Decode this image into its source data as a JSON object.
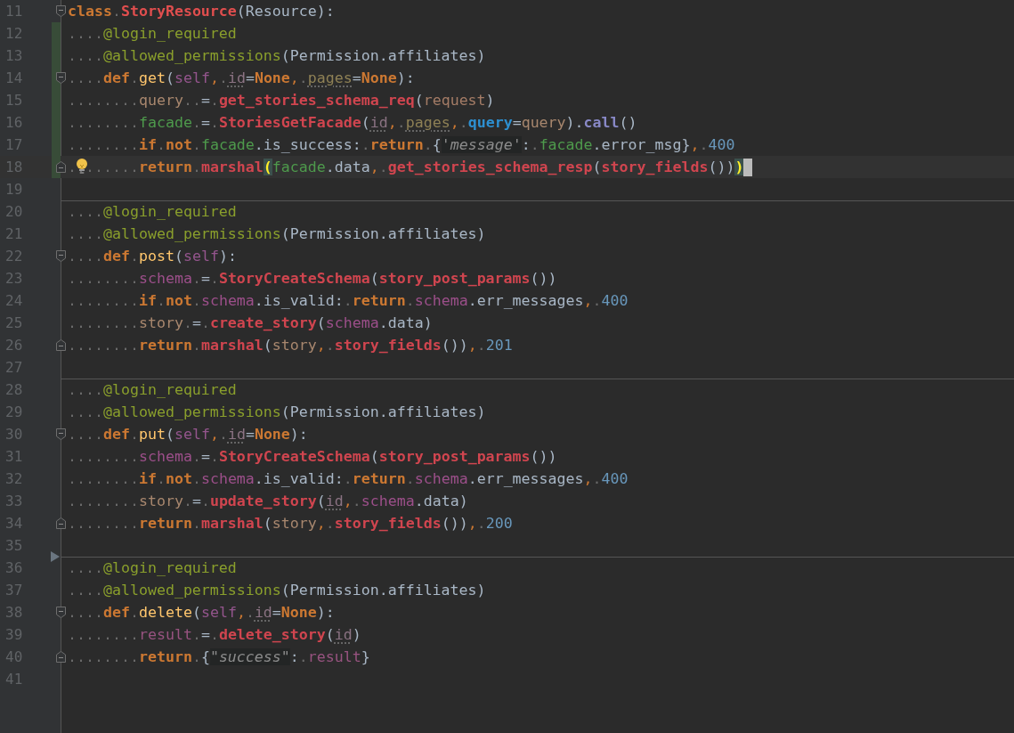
{
  "editor": {
    "lines": [
      {
        "number": "11",
        "fold_start": true,
        "tokens": [
          {
            "kind": "kw",
            "text": "class"
          },
          {
            "kind": "ws",
            "text": "."
          },
          {
            "kind": "cls",
            "text": "StoryResource"
          },
          {
            "kind": "plain",
            "text": "(Resource):"
          }
        ]
      },
      {
        "number": "12",
        "changed": true,
        "tokens": [
          {
            "kind": "ws",
            "text": "...."
          },
          {
            "kind": "dec",
            "text": "@login_required"
          }
        ]
      },
      {
        "number": "13",
        "changed": true,
        "tokens": [
          {
            "kind": "ws",
            "text": "...."
          },
          {
            "kind": "dec",
            "text": "@allowed_permissions"
          },
          {
            "kind": "plain",
            "text": "(Permission.affiliates)"
          }
        ]
      },
      {
        "number": "14",
        "fold_start": true,
        "changed": true,
        "tokens": [
          {
            "kind": "ws",
            "text": "...."
          },
          {
            "kind": "kw",
            "text": "def"
          },
          {
            "kind": "ws",
            "text": "."
          },
          {
            "kind": "fn",
            "text": "get"
          },
          {
            "kind": "plain",
            "text": "("
          },
          {
            "kind": "self",
            "text": "self"
          },
          {
            "kind": "comma",
            "text": ","
          },
          {
            "kind": "ws",
            "text": "."
          },
          {
            "kind": "param",
            "text": "id",
            "color": "#8b7383"
          },
          {
            "kind": "plain",
            "text": "="
          },
          {
            "kind": "kw",
            "text": "None"
          },
          {
            "kind": "comma",
            "text": ","
          },
          {
            "kind": "ws",
            "text": "."
          },
          {
            "kind": "param",
            "text": "pages",
            "color": "#8e8055"
          },
          {
            "kind": "plain",
            "text": "="
          },
          {
            "kind": "kw",
            "text": "None"
          },
          {
            "kind": "plain",
            "text": "):"
          }
        ]
      },
      {
        "number": "15",
        "changed": true,
        "tokens": [
          {
            "kind": "ws",
            "text": "........"
          },
          {
            "kind": "var",
            "text": "query",
            "color": "#a8876e"
          },
          {
            "kind": "ws",
            "text": ".."
          },
          {
            "kind": "plain",
            "text": "="
          },
          {
            "kind": "ws",
            "text": "."
          },
          {
            "kind": "call",
            "text": "get_stories_schema_req"
          },
          {
            "kind": "plain",
            "text": "("
          },
          {
            "kind": "var",
            "text": "request",
            "color": "#a47c66"
          },
          {
            "kind": "plain",
            "text": ")"
          }
        ]
      },
      {
        "number": "16",
        "changed": true,
        "tokens": [
          {
            "kind": "ws",
            "text": "........"
          },
          {
            "kind": "var",
            "text": "facade",
            "color": "#4e9a4c"
          },
          {
            "kind": "ws",
            "text": "."
          },
          {
            "kind": "plain",
            "text": "="
          },
          {
            "kind": "ws",
            "text": "."
          },
          {
            "kind": "call",
            "text": "StoriesGetFacade"
          },
          {
            "kind": "plain",
            "text": "("
          },
          {
            "kind": "param",
            "text": "id",
            "color": "#8b7383"
          },
          {
            "kind": "comma",
            "text": ","
          },
          {
            "kind": "ws",
            "text": "."
          },
          {
            "kind": "param",
            "text": "pages",
            "color": "#8e8055"
          },
          {
            "kind": "comma",
            "text": ","
          },
          {
            "kind": "ws",
            "text": "."
          },
          {
            "kind": "kwarg",
            "text": "query"
          },
          {
            "kind": "plain",
            "text": "="
          },
          {
            "kind": "var",
            "text": "query",
            "color": "#a8876e"
          },
          {
            "kind": "plain",
            "text": ")."
          },
          {
            "kind": "method",
            "text": "call"
          },
          {
            "kind": "plain",
            "text": "()"
          }
        ]
      },
      {
        "number": "17",
        "changed": true,
        "tokens": [
          {
            "kind": "ws",
            "text": "........"
          },
          {
            "kind": "kw",
            "text": "if"
          },
          {
            "kind": "ws",
            "text": "."
          },
          {
            "kind": "kw",
            "text": "not"
          },
          {
            "kind": "ws",
            "text": "."
          },
          {
            "kind": "var",
            "text": "facade",
            "color": "#4e9a4c"
          },
          {
            "kind": "plain",
            "text": ".is_success:"
          },
          {
            "kind": "ws",
            "text": "."
          },
          {
            "kind": "kw",
            "text": "return"
          },
          {
            "kind": "ws",
            "text": "."
          },
          {
            "kind": "plain",
            "text": "{"
          },
          {
            "kind": "str",
            "text": "'message'"
          },
          {
            "kind": "plain",
            "text": ":"
          },
          {
            "kind": "ws",
            "text": "."
          },
          {
            "kind": "var",
            "text": "facade",
            "color": "#4e9a4c"
          },
          {
            "kind": "plain",
            "text": ".error_msg}"
          },
          {
            "kind": "comma",
            "text": ","
          },
          {
            "kind": "ws",
            "text": "."
          },
          {
            "kind": "num",
            "text": "400"
          }
        ]
      },
      {
        "number": "18",
        "fold_end": true,
        "changed": true,
        "current": true,
        "bulb": true,
        "cursor": true,
        "tokens": [
          {
            "kind": "ws",
            "text": "........"
          },
          {
            "kind": "kw",
            "text": "return"
          },
          {
            "kind": "ws",
            "text": "."
          },
          {
            "kind": "call",
            "text": "marshal"
          },
          {
            "kind": "brace",
            "text": "("
          },
          {
            "kind": "var",
            "text": "facade",
            "color": "#4e9a4c"
          },
          {
            "kind": "plain",
            "text": ".data"
          },
          {
            "kind": "comma",
            "text": ","
          },
          {
            "kind": "ws",
            "text": "."
          },
          {
            "kind": "call",
            "text": "get_stories_schema_resp"
          },
          {
            "kind": "plain",
            "text": "("
          },
          {
            "kind": "call",
            "text": "story_fields"
          },
          {
            "kind": "plain",
            "text": "())"
          },
          {
            "kind": "brace",
            "text": ")"
          }
        ]
      },
      {
        "number": "19"
      },
      {
        "number": "20",
        "separator": true,
        "tokens": [
          {
            "kind": "ws",
            "text": "...."
          },
          {
            "kind": "dec",
            "text": "@login_required"
          }
        ]
      },
      {
        "number": "21",
        "tokens": [
          {
            "kind": "ws",
            "text": "...."
          },
          {
            "kind": "dec",
            "text": "@allowed_permissions"
          },
          {
            "kind": "plain",
            "text": "(Permission.affiliates)"
          }
        ]
      },
      {
        "number": "22",
        "fold_start": true,
        "tokens": [
          {
            "kind": "ws",
            "text": "...."
          },
          {
            "kind": "kw",
            "text": "def"
          },
          {
            "kind": "ws",
            "text": "."
          },
          {
            "kind": "fn",
            "text": "post"
          },
          {
            "kind": "plain",
            "text": "("
          },
          {
            "kind": "self",
            "text": "self"
          },
          {
            "kind": "plain",
            "text": "):"
          }
        ]
      },
      {
        "number": "23",
        "tokens": [
          {
            "kind": "ws",
            "text": "........"
          },
          {
            "kind": "var",
            "text": "schema",
            "color": "#9c4f8a"
          },
          {
            "kind": "ws",
            "text": "."
          },
          {
            "kind": "plain",
            "text": "="
          },
          {
            "kind": "ws",
            "text": "."
          },
          {
            "kind": "call",
            "text": "StoryCreateSchema"
          },
          {
            "kind": "plain",
            "text": "("
          },
          {
            "kind": "call",
            "text": "story_post_params"
          },
          {
            "kind": "plain",
            "text": "())"
          }
        ]
      },
      {
        "number": "24",
        "tokens": [
          {
            "kind": "ws",
            "text": "........"
          },
          {
            "kind": "kw",
            "text": "if"
          },
          {
            "kind": "ws",
            "text": "."
          },
          {
            "kind": "kw",
            "text": "not"
          },
          {
            "kind": "ws",
            "text": "."
          },
          {
            "kind": "var",
            "text": "schema",
            "color": "#9c4f8a"
          },
          {
            "kind": "plain",
            "text": ".is_valid:"
          },
          {
            "kind": "ws",
            "text": "."
          },
          {
            "kind": "kw",
            "text": "return"
          },
          {
            "kind": "ws",
            "text": "."
          },
          {
            "kind": "var",
            "text": "schema",
            "color": "#9c4f8a"
          },
          {
            "kind": "plain",
            "text": ".err_messages"
          },
          {
            "kind": "comma",
            "text": ","
          },
          {
            "kind": "ws",
            "text": "."
          },
          {
            "kind": "num",
            "text": "400"
          }
        ]
      },
      {
        "number": "25",
        "tokens": [
          {
            "kind": "ws",
            "text": "........"
          },
          {
            "kind": "var",
            "text": "story",
            "color": "#a8876e"
          },
          {
            "kind": "ws",
            "text": "."
          },
          {
            "kind": "plain",
            "text": "="
          },
          {
            "kind": "ws",
            "text": "."
          },
          {
            "kind": "call",
            "text": "create_story"
          },
          {
            "kind": "plain",
            "text": "("
          },
          {
            "kind": "var",
            "text": "schema",
            "color": "#9c4f8a"
          },
          {
            "kind": "plain",
            "text": ".data)"
          }
        ]
      },
      {
        "number": "26",
        "fold_end": true,
        "tokens": [
          {
            "kind": "ws",
            "text": "........"
          },
          {
            "kind": "kw",
            "text": "return"
          },
          {
            "kind": "ws",
            "text": "."
          },
          {
            "kind": "call",
            "text": "marshal"
          },
          {
            "kind": "plain",
            "text": "("
          },
          {
            "kind": "var",
            "text": "story",
            "color": "#a8876e"
          },
          {
            "kind": "comma",
            "text": ","
          },
          {
            "kind": "ws",
            "text": "."
          },
          {
            "kind": "call",
            "text": "story_fields"
          },
          {
            "kind": "plain",
            "text": "())"
          },
          {
            "kind": "comma",
            "text": ","
          },
          {
            "kind": "ws",
            "text": "."
          },
          {
            "kind": "num",
            "text": "201"
          }
        ]
      },
      {
        "number": "27"
      },
      {
        "number": "28",
        "separator": true,
        "tokens": [
          {
            "kind": "ws",
            "text": "...."
          },
          {
            "kind": "dec",
            "text": "@login_required"
          }
        ]
      },
      {
        "number": "29",
        "tokens": [
          {
            "kind": "ws",
            "text": "...."
          },
          {
            "kind": "dec",
            "text": "@allowed_permissions"
          },
          {
            "kind": "plain",
            "text": "(Permission.affiliates)"
          }
        ]
      },
      {
        "number": "30",
        "fold_start": true,
        "tokens": [
          {
            "kind": "ws",
            "text": "...."
          },
          {
            "kind": "kw",
            "text": "def"
          },
          {
            "kind": "ws",
            "text": "."
          },
          {
            "kind": "fn",
            "text": "put"
          },
          {
            "kind": "plain",
            "text": "("
          },
          {
            "kind": "self",
            "text": "self"
          },
          {
            "kind": "comma",
            "text": ","
          },
          {
            "kind": "ws",
            "text": "."
          },
          {
            "kind": "param",
            "text": "id",
            "color": "#8b7383"
          },
          {
            "kind": "plain",
            "text": "="
          },
          {
            "kind": "kw",
            "text": "None"
          },
          {
            "kind": "plain",
            "text": "):"
          }
        ]
      },
      {
        "number": "31",
        "tokens": [
          {
            "kind": "ws",
            "text": "........"
          },
          {
            "kind": "var",
            "text": "schema",
            "color": "#9c4f8a"
          },
          {
            "kind": "ws",
            "text": "."
          },
          {
            "kind": "plain",
            "text": "="
          },
          {
            "kind": "ws",
            "text": "."
          },
          {
            "kind": "call",
            "text": "StoryCreateSchema"
          },
          {
            "kind": "plain",
            "text": "("
          },
          {
            "kind": "call",
            "text": "story_post_params"
          },
          {
            "kind": "plain",
            "text": "())"
          }
        ]
      },
      {
        "number": "32",
        "tokens": [
          {
            "kind": "ws",
            "text": "........"
          },
          {
            "kind": "kw",
            "text": "if"
          },
          {
            "kind": "ws",
            "text": "."
          },
          {
            "kind": "kw",
            "text": "not"
          },
          {
            "kind": "ws",
            "text": "."
          },
          {
            "kind": "var",
            "text": "schema",
            "color": "#9c4f8a"
          },
          {
            "kind": "plain",
            "text": ".is_valid:"
          },
          {
            "kind": "ws",
            "text": "."
          },
          {
            "kind": "kw",
            "text": "return"
          },
          {
            "kind": "ws",
            "text": "."
          },
          {
            "kind": "var",
            "text": "schema",
            "color": "#9c4f8a"
          },
          {
            "kind": "plain",
            "text": ".err_messages"
          },
          {
            "kind": "comma",
            "text": ","
          },
          {
            "kind": "ws",
            "text": "."
          },
          {
            "kind": "num",
            "text": "400"
          }
        ]
      },
      {
        "number": "33",
        "tokens": [
          {
            "kind": "ws",
            "text": "........"
          },
          {
            "kind": "var",
            "text": "story",
            "color": "#a8876e"
          },
          {
            "kind": "ws",
            "text": "."
          },
          {
            "kind": "plain",
            "text": "="
          },
          {
            "kind": "ws",
            "text": "."
          },
          {
            "kind": "call",
            "text": "update_story"
          },
          {
            "kind": "plain",
            "text": "("
          },
          {
            "kind": "param",
            "text": "id",
            "color": "#8b7383"
          },
          {
            "kind": "comma",
            "text": ","
          },
          {
            "kind": "ws",
            "text": "."
          },
          {
            "kind": "var",
            "text": "schema",
            "color": "#9c4f8a"
          },
          {
            "kind": "plain",
            "text": ".data)"
          }
        ]
      },
      {
        "number": "34",
        "fold_end": true,
        "tokens": [
          {
            "kind": "ws",
            "text": "........"
          },
          {
            "kind": "kw",
            "text": "return"
          },
          {
            "kind": "ws",
            "text": "."
          },
          {
            "kind": "call",
            "text": "marshal"
          },
          {
            "kind": "plain",
            "text": "("
          },
          {
            "kind": "var",
            "text": "story",
            "color": "#a8876e"
          },
          {
            "kind": "comma",
            "text": ","
          },
          {
            "kind": "ws",
            "text": "."
          },
          {
            "kind": "call",
            "text": "story_fields"
          },
          {
            "kind": "plain",
            "text": "())"
          },
          {
            "kind": "comma",
            "text": ","
          },
          {
            "kind": "ws",
            "text": "."
          },
          {
            "kind": "num",
            "text": "200"
          }
        ]
      },
      {
        "number": "35",
        "arrow": true
      },
      {
        "number": "36",
        "separator": true,
        "tokens": [
          {
            "kind": "ws",
            "text": "...."
          },
          {
            "kind": "dec",
            "text": "@login_required"
          }
        ]
      },
      {
        "number": "37",
        "tokens": [
          {
            "kind": "ws",
            "text": "...."
          },
          {
            "kind": "dec",
            "text": "@allowed_permissions"
          },
          {
            "kind": "plain",
            "text": "(Permission.affiliates)"
          }
        ]
      },
      {
        "number": "38",
        "fold_start": true,
        "tokens": [
          {
            "kind": "ws",
            "text": "...."
          },
          {
            "kind": "kw",
            "text": "def"
          },
          {
            "kind": "ws",
            "text": "."
          },
          {
            "kind": "fn",
            "text": "delete"
          },
          {
            "kind": "plain",
            "text": "("
          },
          {
            "kind": "self",
            "text": "self"
          },
          {
            "kind": "comma",
            "text": ","
          },
          {
            "kind": "ws",
            "text": "."
          },
          {
            "kind": "param",
            "text": "id",
            "color": "#8b7383"
          },
          {
            "kind": "plain",
            "text": "="
          },
          {
            "kind": "kw",
            "text": "None"
          },
          {
            "kind": "plain",
            "text": "):"
          }
        ]
      },
      {
        "number": "39",
        "tokens": [
          {
            "kind": "ws",
            "text": "........"
          },
          {
            "kind": "var",
            "text": "result",
            "color": "#985380"
          },
          {
            "kind": "ws",
            "text": "."
          },
          {
            "kind": "plain",
            "text": "="
          },
          {
            "kind": "ws",
            "text": "."
          },
          {
            "kind": "call",
            "text": "delete_story"
          },
          {
            "kind": "plain",
            "text": "("
          },
          {
            "kind": "param",
            "text": "id",
            "color": "#8b7383"
          },
          {
            "kind": "plain",
            "text": ")"
          }
        ]
      },
      {
        "number": "40",
        "fold_end": true,
        "tokens": [
          {
            "kind": "ws",
            "text": "........"
          },
          {
            "kind": "kw",
            "text": "return"
          },
          {
            "kind": "ws",
            "text": "."
          },
          {
            "kind": "plain",
            "text": "{"
          },
          {
            "kind": "str",
            "text": "\"success\""
          },
          {
            "kind": "plain",
            "text": ":"
          },
          {
            "kind": "ws",
            "text": "."
          },
          {
            "kind": "var",
            "text": "result",
            "color": "#985380"
          },
          {
            "kind": "plain",
            "text": "}"
          }
        ]
      },
      {
        "number": "41"
      }
    ]
  }
}
